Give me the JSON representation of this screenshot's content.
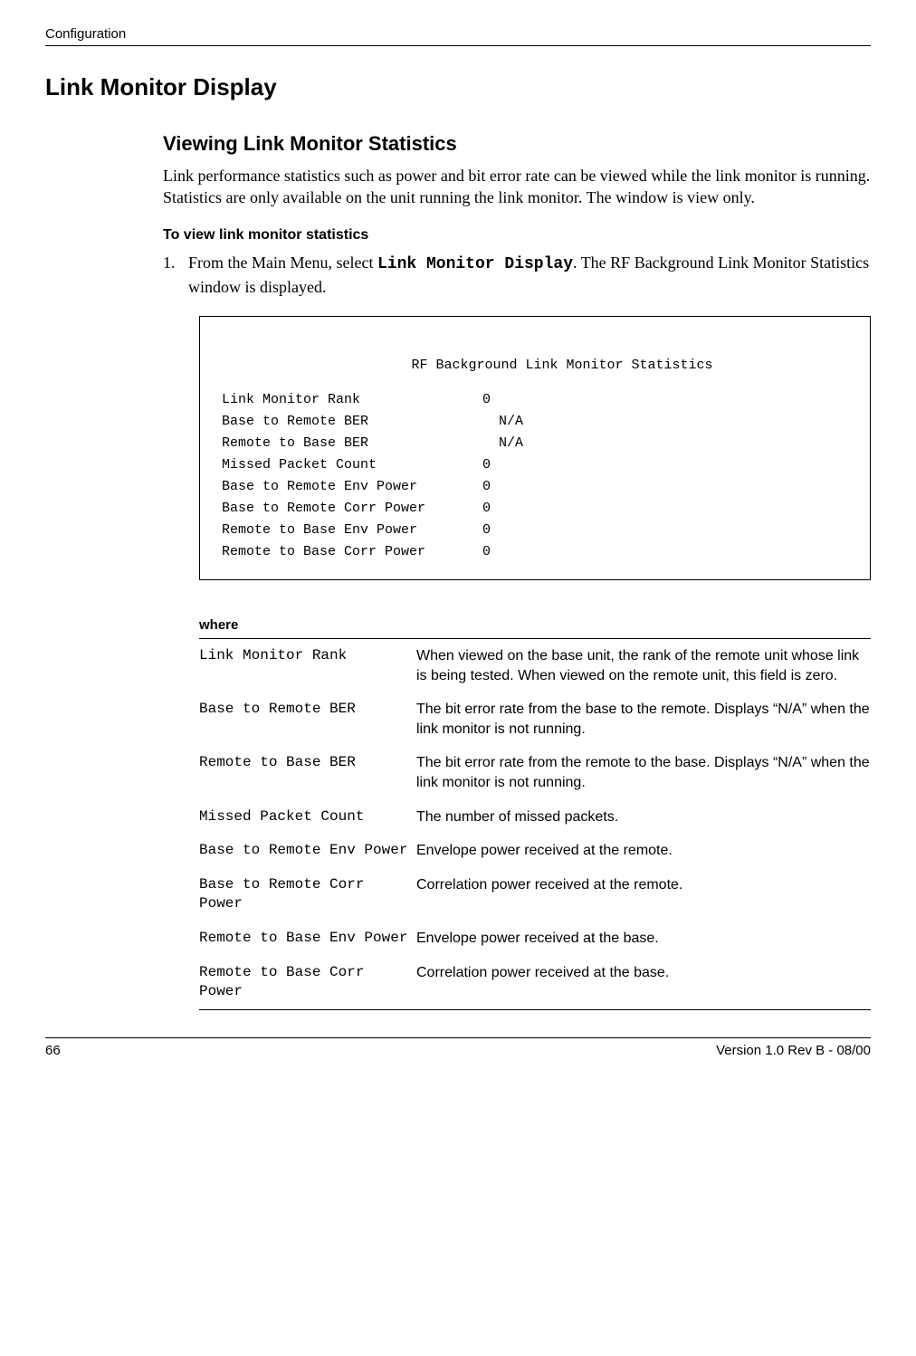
{
  "header": {
    "section": "Configuration"
  },
  "main": {
    "h1": "Link Monitor Display",
    "h2": "Viewing Link Monitor Statistics",
    "intro": "Link performance statistics such as power and bit error rate can be viewed while the link monitor is running. Statistics are only available on the unit running the link monitor. The window is view only.",
    "h3": "To view link monitor statistics",
    "step1": {
      "num": "1.",
      "text_a": "From the Main Menu, select ",
      "code": "Link Monitor Display",
      "text_b": ". The RF Background Link Monitor Statistics window is displayed."
    }
  },
  "term": {
    "title": "RF Background Link Monitor Statistics",
    "rows": [
      {
        "label": "Link Monitor Rank",
        "value": "0"
      },
      {
        "label": "Base to Remote BER",
        "value": "  N/A"
      },
      {
        "label": "Remote to Base BER",
        "value": "  N/A"
      },
      {
        "label": "Missed Packet Count",
        "value": "0"
      },
      {
        "label": "Base to Remote Env Power",
        "value": "0"
      },
      {
        "label": "Base to Remote Corr Power",
        "value": "0"
      },
      {
        "label": "Remote to Base Env Power",
        "value": "0"
      },
      {
        "label": "Remote to Base Corr Power",
        "value": "0"
      }
    ]
  },
  "where": {
    "label": "where",
    "rows": [
      {
        "term": "Link Monitor Rank",
        "desc": "When viewed on the base unit, the rank of the remote unit whose link is being tested. When viewed on the remote unit, this field is zero."
      },
      {
        "term": "Base to Remote BER",
        "desc": "The bit error rate from the base to the remote. Displays “N/A” when the link monitor is not running."
      },
      {
        "term": "Remote to Base BER",
        "desc": "The bit error rate from the remote to the base. Displays “N/A” when the link monitor is not running."
      },
      {
        "term": "Missed Packet Count",
        "desc": "The number of missed packets."
      },
      {
        "term": "Base to Remote Env Power",
        "desc": "Envelope power received at the remote."
      },
      {
        "term": "Base to Remote Corr Power",
        "desc": "Correlation power received at the remote."
      },
      {
        "term": "Remote to Base Env Power",
        "desc": "Envelope power received at the base."
      },
      {
        "term": "Remote to Base Corr Power",
        "desc": "Correlation power received at the base."
      }
    ]
  },
  "footer": {
    "page": "66",
    "version": "Version 1.0 Rev B - 08/00"
  }
}
